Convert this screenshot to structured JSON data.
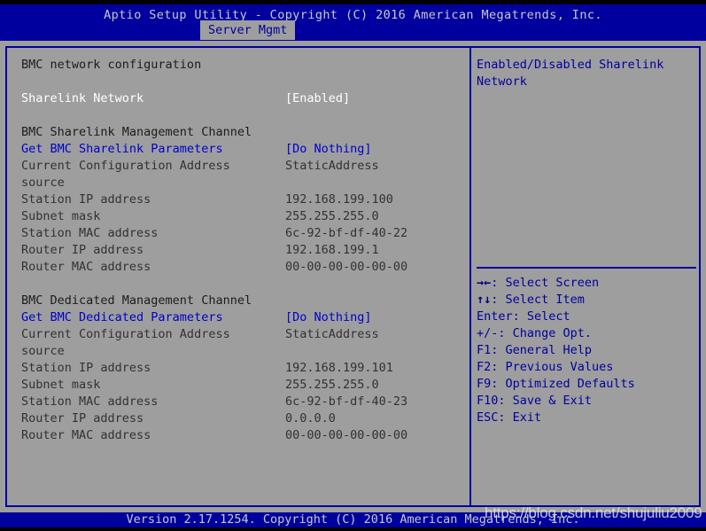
{
  "header": {
    "title": "Aptio Setup Utility - Copyright (C) 2016 American Megatrends, Inc.",
    "active_tab": "Server Mgmt"
  },
  "colors": {
    "header_bg": "#00009e",
    "desktop_bg": "#9e9e9e",
    "border": "#00009e",
    "link": "#0000cd",
    "selected": "#ffffff",
    "heading": "#1c1c1c",
    "dim": "#323232"
  },
  "main": {
    "rows": [
      {
        "label": "BMC network configuration",
        "value": "",
        "style": "c-head",
        "kind": "section-heading"
      },
      {
        "label": "",
        "value": "",
        "style": "spacer",
        "kind": "spacer"
      },
      {
        "label": "Sharelink Network",
        "value": "[Enabled]",
        "style": "c-sel",
        "kind": "option"
      },
      {
        "label": "",
        "value": "",
        "style": "spacer",
        "kind": "spacer"
      },
      {
        "label": "BMC Sharelink Management Channel",
        "value": "",
        "style": "c-head",
        "kind": "section-heading"
      },
      {
        "label": "Get BMC Sharelink Parameters",
        "value": "[Do Nothing]",
        "style": "c-link",
        "kind": "option"
      },
      {
        "label": "Current Configuration Address",
        "value": "StaticAddress",
        "style": "c-dim",
        "kind": "readonly"
      },
      {
        "label": "source",
        "value": "",
        "style": "c-dim",
        "kind": "readonly"
      },
      {
        "label": "Station IP address",
        "value": "192.168.199.100",
        "style": "c-dim",
        "kind": "readonly"
      },
      {
        "label": "Subnet mask",
        "value": "255.255.255.0",
        "style": "c-dim",
        "kind": "readonly"
      },
      {
        "label": "Station MAC address",
        "value": "6c-92-bf-df-40-22",
        "style": "c-dim",
        "kind": "readonly"
      },
      {
        "label": "Router IP address",
        "value": "192.168.199.1",
        "style": "c-dim",
        "kind": "readonly"
      },
      {
        "label": "Router MAC address",
        "value": "00-00-00-00-00-00",
        "style": "c-dim",
        "kind": "readonly"
      },
      {
        "label": "",
        "value": "",
        "style": "spacer",
        "kind": "spacer"
      },
      {
        "label": "BMC Dedicated Management Channel",
        "value": "",
        "style": "c-head",
        "kind": "section-heading"
      },
      {
        "label": "Get BMC Dedicated Parameters",
        "value": "[Do Nothing]",
        "style": "c-link",
        "kind": "option"
      },
      {
        "label": "Current Configuration Address",
        "value": "StaticAddress",
        "style": "c-dim",
        "kind": "readonly"
      },
      {
        "label": "source",
        "value": "",
        "style": "c-dim",
        "kind": "readonly"
      },
      {
        "label": "Station IP address",
        "value": "192.168.199.101",
        "style": "c-dim",
        "kind": "readonly"
      },
      {
        "label": "Subnet mask",
        "value": "255.255.255.0",
        "style": "c-dim",
        "kind": "readonly"
      },
      {
        "label": "Station MAC address",
        "value": "6c-92-bf-df-40-23",
        "style": "c-dim",
        "kind": "readonly"
      },
      {
        "label": "Router IP address",
        "value": "0.0.0.0",
        "style": "c-dim",
        "kind": "readonly"
      },
      {
        "label": "Router MAC address",
        "value": "00-00-00-00-00-00",
        "style": "c-dim",
        "kind": "readonly"
      }
    ]
  },
  "help": {
    "description_lines": [
      "Enabled/Disabled Sharelink",
      "Network"
    ],
    "keys": [
      {
        "glyph": "→←",
        "text": ": Select Screen"
      },
      {
        "glyph": "↑↓",
        "text": ": Select Item"
      },
      {
        "glyph": "",
        "text": "Enter: Select"
      },
      {
        "glyph": "",
        "text": "+/-: Change Opt."
      },
      {
        "glyph": "",
        "text": "F1: General Help"
      },
      {
        "glyph": "",
        "text": "F2: Previous Values"
      },
      {
        "glyph": "",
        "text": "F9: Optimized Defaults"
      },
      {
        "glyph": "",
        "text": "F10: Save & Exit"
      },
      {
        "glyph": "",
        "text": "ESC: Exit"
      }
    ]
  },
  "footer": {
    "text": "Version 2.17.1254. Copyright (C) 2016 American Megatrends, Inc."
  },
  "watermark": {
    "text": "https://blog.csdn.net/shujuliu2009"
  }
}
